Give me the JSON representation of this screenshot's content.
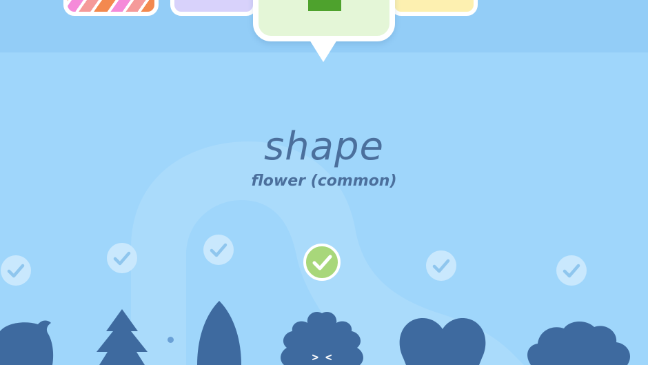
{
  "title": "shape",
  "subtitle": "flower (common)",
  "colors": {
    "background": "#9fd6fb",
    "top_bar": "#93cdf7",
    "silhouette": "#3e6a9f",
    "text": "#4b6f9c",
    "selected_check": "#a8d77a",
    "selected_tile": "#e4f6d7"
  },
  "shapes": [
    {
      "name": "round-creature",
      "unlocked": true
    },
    {
      "name": "pine-tree",
      "unlocked": true
    },
    {
      "name": "leaf",
      "unlocked": true
    },
    {
      "name": "flower",
      "unlocked": true,
      "selected": true,
      "face": "> <"
    },
    {
      "name": "heart",
      "unlocked": true
    },
    {
      "name": "cloud",
      "unlocked": true
    }
  ]
}
